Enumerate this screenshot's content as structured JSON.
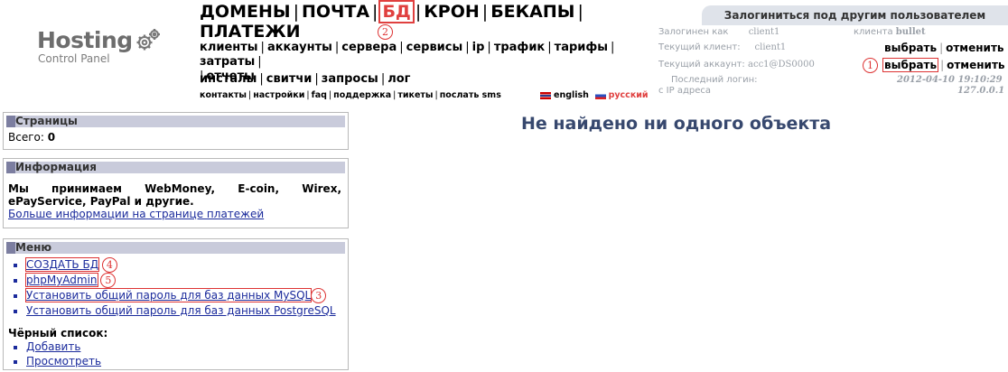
{
  "logo": {
    "title": "Hosting",
    "subtitle": "Control Panel"
  },
  "nav_main": [
    "ДОМЕНЫ",
    "ПОЧТА",
    "БД",
    "КРОН",
    "БЕКАПЫ",
    "ПЛАТЕЖИ"
  ],
  "nav_admin": [
    "клиенты",
    "аккаунты",
    "сервера",
    "сервисы",
    "ip",
    "трафик",
    "тарифы",
    "затраты",
    "отчеты"
  ],
  "nav_admin2": [
    "инсталы",
    "свитчи",
    "запросы",
    "лог"
  ],
  "nav_small": [
    "контакты",
    "настройки",
    "faq",
    "поддержка",
    "тикеты",
    "послать sms"
  ],
  "languages": [
    "english",
    "русский"
  ],
  "login_panel": {
    "tab_title": "Залогиниться под другим пользователем",
    "logged_as_label": "Залогинен как",
    "logged_as_value": "client1",
    "client_label": "клиента",
    "client_value": "bullet",
    "current_client_label": "Текущий клиент:",
    "current_client_value": "client1",
    "current_account_label": "Текущий аккаунт:",
    "current_account_value": "acc1@DS0000",
    "select_label": "выбрать",
    "cancel_label": "отменить",
    "last_login_label": "Последний логин:",
    "last_login_value": "2012-04-10 19:10:29",
    "from_ip_label": "с IP адреса",
    "from_ip_value": "127.0.0.1"
  },
  "markers": [
    "1",
    "2",
    "3",
    "4",
    "5"
  ],
  "pages_panel": {
    "title": "Страницы",
    "total_label": "Всего:",
    "total_value": "0"
  },
  "info_panel": {
    "title": "Информация",
    "text": "Мы принимаем WebMoney, E-coin, Wirex, ePayService, PayPal и другие.",
    "link": "Больше информации на странице платежей"
  },
  "menu_panel": {
    "title": "Меню",
    "items": [
      "СОЗДАТЬ БД",
      "phpMyAdmin",
      "Установить общий пароль для баз данных MySQL",
      "Установить общий пароль для баз данных PostgreSQL"
    ],
    "blacklist_title": "Чёрный список:",
    "blacklist_items": [
      "Добавить",
      "Просмотреть"
    ]
  },
  "main": {
    "empty_message": "Не найдено ни одного объекта"
  },
  "colors": {
    "annotation": "#d33333",
    "heading": "#37486e",
    "panel_header": "#c9cbdb"
  }
}
